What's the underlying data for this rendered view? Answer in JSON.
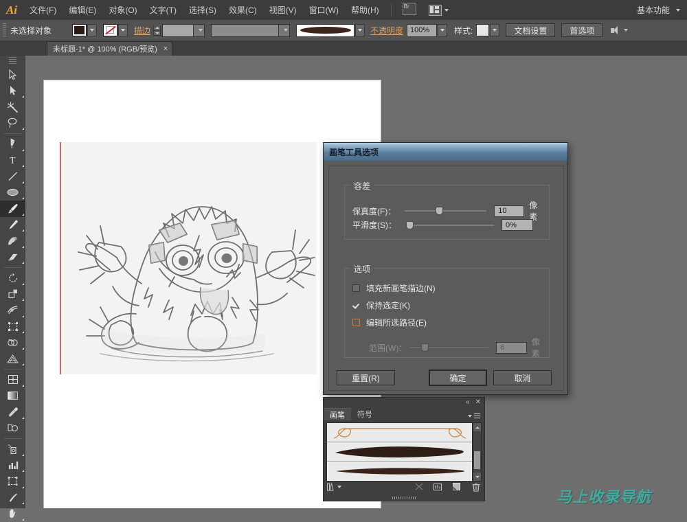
{
  "app": {
    "logo": "Ai",
    "workspace": "基本功能"
  },
  "menubar": {
    "items": [
      {
        "label": "文件(F)"
      },
      {
        "label": "编辑(E)"
      },
      {
        "label": "对象(O)"
      },
      {
        "label": "文字(T)"
      },
      {
        "label": "选择(S)"
      },
      {
        "label": "效果(C)"
      },
      {
        "label": "视图(V)"
      },
      {
        "label": "窗口(W)"
      },
      {
        "label": "帮助(H)"
      }
    ],
    "bridge_icon": "bridge-icon",
    "arrange_icon": "arrange-documents-icon"
  },
  "controlbar": {
    "selection_status": "未选择对象",
    "fill_label": "fill-swatch",
    "fill_color": "#2b1b14",
    "stroke_none_label": "stroke-none-swatch",
    "stroke_label": "描边",
    "stroke_weight": "",
    "stroke_profile": "",
    "brush_definition": "brush-definition",
    "opacity_label": "不透明度",
    "opacity_value": "100%",
    "style_label": "样式:",
    "doc_setup": "文档设置",
    "preferences": "首选项",
    "sound_icon": "sound-icon"
  },
  "tabbar": {
    "doc_title": "未标题-1* @ 100% (RGB/预览)",
    "close": "×"
  },
  "toolbar": {
    "tools": [
      {
        "name": "selection-tool"
      },
      {
        "name": "direct-selection-tool"
      },
      {
        "name": "magic-wand-tool"
      },
      {
        "name": "lasso-tool"
      },
      {
        "name": "pen-tool"
      },
      {
        "name": "type-tool"
      },
      {
        "name": "line-segment-tool"
      },
      {
        "name": "ellipse-tool"
      },
      {
        "name": "paintbrush-tool"
      },
      {
        "name": "pencil-tool"
      },
      {
        "name": "blob-brush-tool"
      },
      {
        "name": "eraser-tool"
      },
      {
        "name": "rotate-tool"
      },
      {
        "name": "scale-tool"
      },
      {
        "name": "width-tool"
      },
      {
        "name": "free-transform-tool"
      },
      {
        "name": "shape-builder-tool"
      },
      {
        "name": "perspective-grid-tool"
      },
      {
        "name": "mesh-tool"
      },
      {
        "name": "gradient-tool"
      },
      {
        "name": "eyedropper-tool"
      },
      {
        "name": "blend-tool"
      },
      {
        "name": "symbol-sprayer-tool"
      },
      {
        "name": "column-graph-tool"
      },
      {
        "name": "artboard-tool"
      },
      {
        "name": "slice-tool"
      },
      {
        "name": "hand-tool"
      }
    ],
    "active_tool": "paintbrush-tool"
  },
  "dialog": {
    "title": "画笔工具选项",
    "tolerance_group": "容差",
    "fidelity": {
      "label": "保真度(F)：",
      "value": "10",
      "unit": "像素",
      "slider_pct": 39
    },
    "smoothness": {
      "label": "平滑度(S)：",
      "value": "0%",
      "unit": "",
      "slider_pct": 0
    },
    "options_group": "选项",
    "checkboxes": [
      {
        "label": "填充新画笔描边(N)",
        "checked": false,
        "focused": false,
        "name": "fill-new-brush-strokes-checkbox"
      },
      {
        "label": "保持选定(K)",
        "checked": true,
        "focused": false,
        "name": "keep-selected-checkbox"
      },
      {
        "label": "编辑所选路径(E)",
        "checked": false,
        "focused": true,
        "name": "edit-selected-paths-checkbox"
      }
    ],
    "range": {
      "label": "范围(W)：",
      "value": "6",
      "unit": "像素",
      "slider_pct": 15,
      "disabled": true
    },
    "buttons": {
      "reset": "重置(R)",
      "ok": "确定",
      "cancel": "取消"
    }
  },
  "brush_panel": {
    "tabs": [
      {
        "label": "画笔",
        "active": true
      },
      {
        "label": "符号",
        "active": false
      }
    ],
    "collapse_icon": "collapse-icon",
    "close_icon": "close-icon",
    "menu_icon": "panel-menu-icon",
    "brushes": [
      {
        "name": "brush-thumb-calligraphic-loop",
        "selected": false
      },
      {
        "name": "brush-thumb-thick-tapered",
        "selected": false
      },
      {
        "name": "brush-thumb-thin-tapered",
        "selected": true
      }
    ],
    "footer_icons": [
      {
        "name": "brush-libraries-icon",
        "disabled": false
      },
      {
        "name": "remove-brush-stroke-icon",
        "disabled": true
      },
      {
        "name": "options-of-selected-object-icon",
        "disabled": false
      },
      {
        "name": "new-brush-icon",
        "disabled": false
      },
      {
        "name": "delete-brush-icon",
        "disabled": false
      }
    ]
  },
  "watermark": {
    "text": "马上收录导航",
    "color": "#3aada0"
  }
}
